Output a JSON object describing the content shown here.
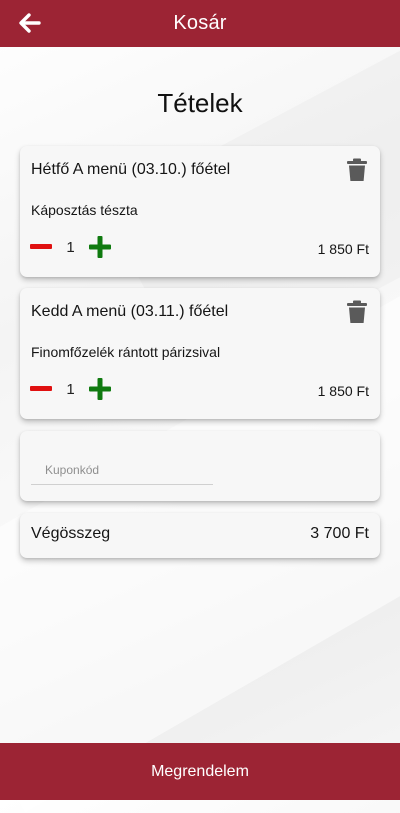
{
  "header": {
    "title": "Kosár",
    "back_icon": "arrow-left-icon"
  },
  "page_title": "Tételek",
  "items": [
    {
      "name": "Hétfő A menü (03.10.) főétel",
      "description": "Káposztás tészta",
      "quantity": "1",
      "price": "1 850 Ft"
    },
    {
      "name": "Kedd A menü (03.11.) főétel",
      "description": "Finomfőzelék rántott párizsival",
      "quantity": "1",
      "price": "1 850 Ft"
    }
  ],
  "coupon": {
    "placeholder": "Kuponkód",
    "value": ""
  },
  "total": {
    "label": "Végösszeg",
    "value": "3 700 Ft"
  },
  "order_button": {
    "label": "Megrendelem"
  },
  "colors": {
    "brand": "#9c2434",
    "minus": "#e01010",
    "plus": "#0f7a0f",
    "trash": "#5a5a5a"
  }
}
